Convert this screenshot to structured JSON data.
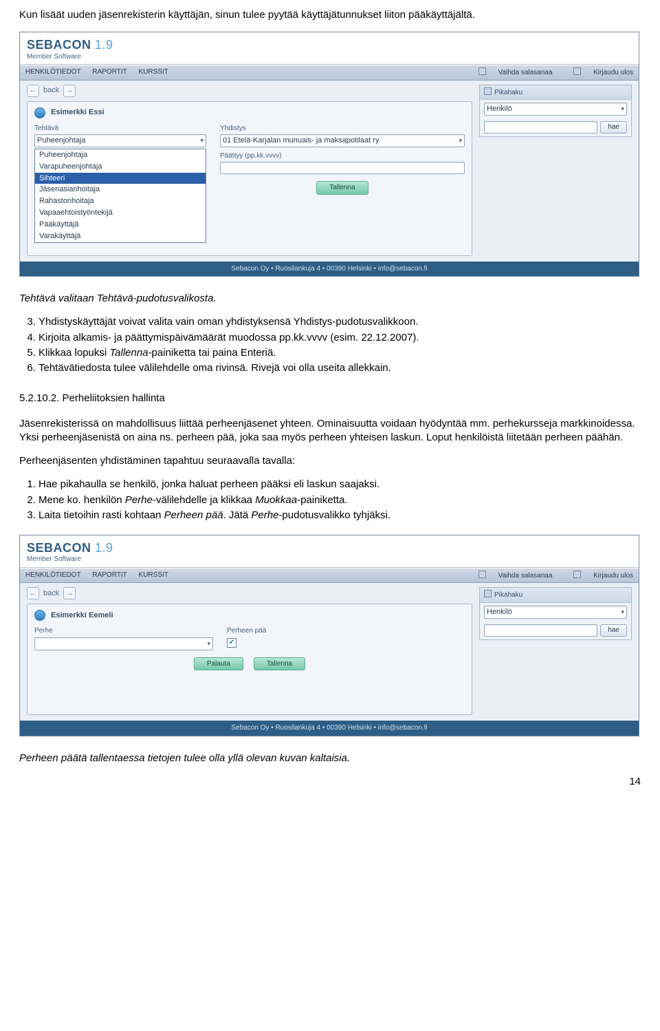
{
  "intro": "Kun lisäät uuden jäsenrekisterin käyttäjän, sinun tulee pyytää käyttäjätunnukset liiton pääkäyttäjältä.",
  "screenshot1": {
    "logo_main": "SEBACON",
    "logo_ver": "1.9",
    "logo_sub": "Member Software",
    "nav_left": [
      "HENKILÖTIEDOT",
      "RAPORTIT",
      "KURSSIT"
    ],
    "nav_right": [
      "Vaihda salasanaa",
      "Kirjaudu ulos"
    ],
    "back": "back",
    "quicksearch_title": "Pikahaku",
    "quicksearch_type": "Henkilö",
    "quicksearch_btn": "hae",
    "person": "Esimerkki Essi",
    "col1_label": "Tehtävä",
    "col1_value": "Puheenjohtaja",
    "col2_label": "Yhdistys",
    "col2_value": "01 Etelä-Karjalan munuais- ja maksapotilaat ry",
    "col3_label": "Päättyy (pp.kk.vvvv)",
    "dropdown": {
      "options": [
        "Puheenjohtaja",
        "Varapuheenjohtaja",
        "Sihteeri",
        "Jäsenasianhoitaja",
        "Rahastonhoitaja",
        "Vapaaehtoistyöntekijä",
        "Pääkäyttäjä",
        "Varakäyttäjä"
      ],
      "selected_index": 2
    },
    "btn_save": "Tallenna",
    "footer": "Sebacon Oy • Ruosilankuja 4 • 00390 Helsinki • info@sebacon.fi"
  },
  "after_ss1": "Tehtävä valitaan Tehtävä-pudotusvalikosta.",
  "list1": {
    "start": 3,
    "items": [
      {
        "pre": "Yhdistyskäyttäjät voivat valita vain oman yhdistyksensä Yhdistys-pudotusvalikkoon."
      },
      {
        "pre": "Kirjoita alkamis- ja päättymispäivämäärät muodossa pp.kk.vvvv (esim. 22.12.2007)."
      },
      {
        "pre": "Klikkaa lopuksi ",
        "it": "Tallenna",
        "post": "-painiketta tai paina Enteriä."
      },
      {
        "pre": "Tehtävätiedosta tulee välilehdelle oma rivinsä. Rivejä voi olla useita allekkain."
      }
    ]
  },
  "section_title": "5.2.10.2. Perheliitoksien hallinta",
  "para_family": "Jäsenrekisterissä on mahdollisuus liittää perheenjäsenet yhteen. Ominaisuutta voidaan hyödyntää mm. perhekursseja markkinoidessa. Yksi perheenjäsenistä on aina ns. perheen pää, joka saa myös perheen yhteisen laskun. Loput henkilöistä liitetään perheen päähän.",
  "para_steps_intro": "Perheenjäsenten yhdistäminen tapahtuu seuraavalla tavalla:",
  "list2": [
    {
      "pre": "Hae pikahaulla se henkilö, jonka haluat perheen pääksi eli laskun saajaksi."
    },
    {
      "pre": "Mene ko. henkilön ",
      "it": "Perhe",
      "mid": "-välilehdelle ja klikkaa ",
      "it2": "Muokkaa",
      "post": "-painiketta."
    },
    {
      "pre": "Laita tietoihin rasti kohtaan ",
      "it": "Perheen pää",
      "mid": ". Jätä ",
      "it2": "Perhe",
      "post": "-pudotusvalikko tyhjäksi."
    }
  ],
  "screenshot2": {
    "person": "Esimerkki Eemeli",
    "col1_label": "Perhe",
    "col2_label": "Perheen pää",
    "btn_reset": "Palauta",
    "btn_save": "Tallenna"
  },
  "caption2_pre": "Perheen päätä tallentaessa tietojen tulee olla yllä olevan kuvan kaltaisia.",
  "page_number": "14"
}
